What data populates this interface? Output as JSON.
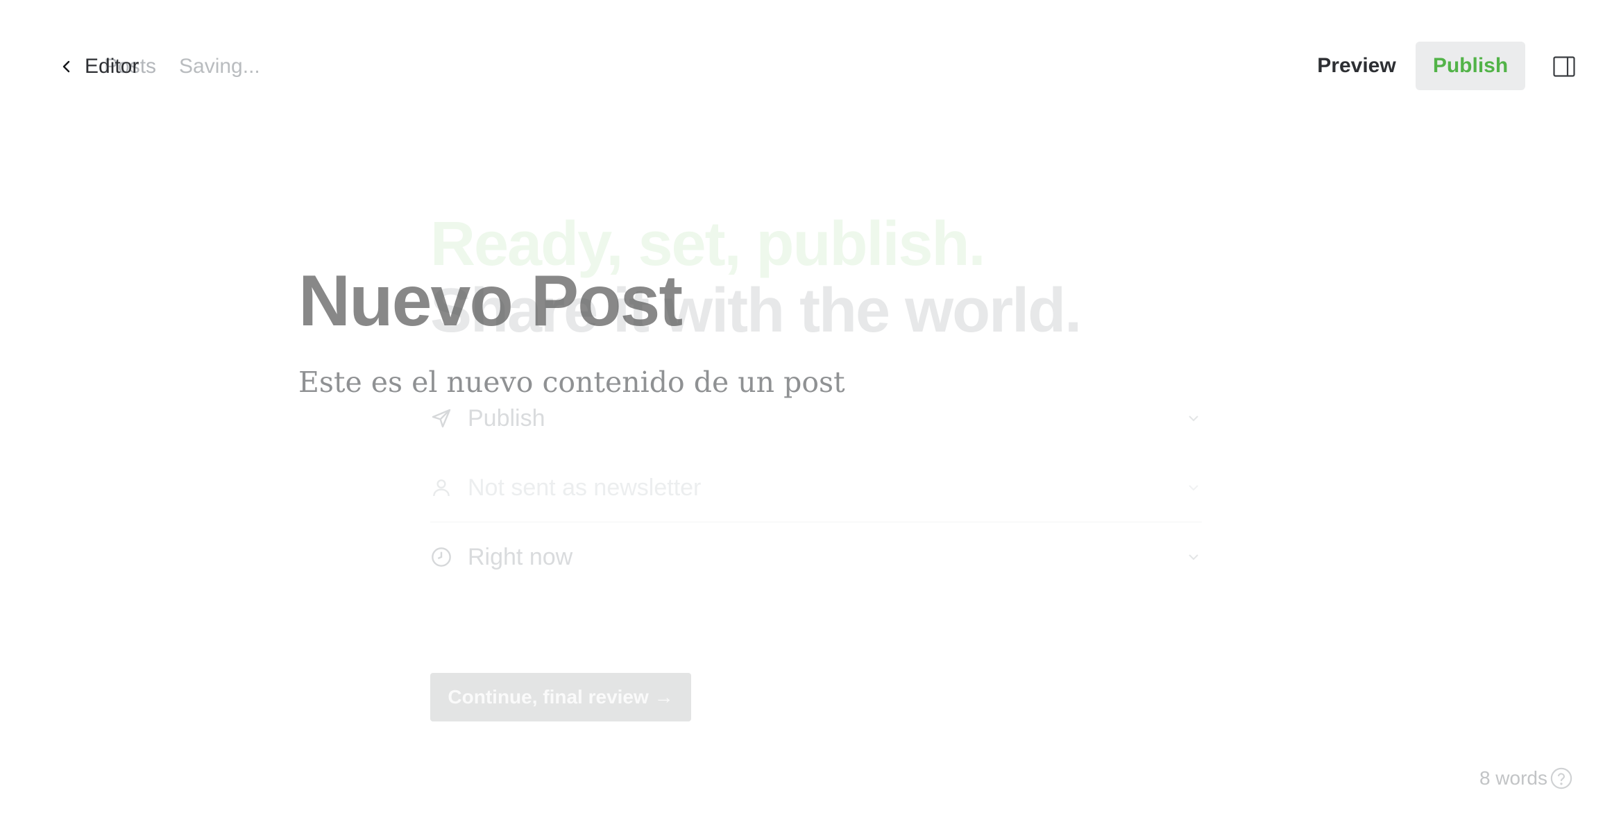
{
  "header": {
    "back_label": "Editor",
    "back_ghost_label": "Posts",
    "save_status": "Saving...",
    "preview_label": "Preview",
    "publish_label": "Publish",
    "publish_color": "#52b348"
  },
  "publish_flow": {
    "heading_line1": "Ready, set, publish.",
    "heading_line2": "Share it with the world.",
    "options": [
      {
        "icon": "send-icon",
        "label": "Publish"
      },
      {
        "icon": "user-icon",
        "label": "Not sent as newsletter"
      },
      {
        "icon": "clock-icon",
        "label": "Right now"
      }
    ],
    "continue_label": "Continue, final review →"
  },
  "post": {
    "title": "Nuevo Post",
    "body": "Este es el nuevo contenido de un post"
  },
  "footer": {
    "word_count": "8 words",
    "help_icon": "question-icon"
  }
}
